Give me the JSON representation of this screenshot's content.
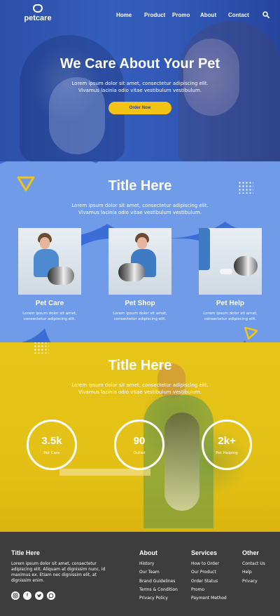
{
  "header": {
    "logo_text": "petcare",
    "nav": [
      {
        "label": "Home"
      },
      {
        "label": "Product"
      },
      {
        "label": "Promo"
      },
      {
        "label": "About"
      },
      {
        "label": "Contact"
      }
    ],
    "search_icon": "search-icon"
  },
  "hero": {
    "title": "We Care About Your Pet",
    "text": "Lorem ipsum dolor sit amet, consectetur adipiscing elit. Vivamus lacinia odio vitae vestibulum vestibulum.",
    "button": "Order Now"
  },
  "services": {
    "title": "Title Here",
    "text": "Lorem ipsum dolor sit amet, consectetur adipiscing elit. Vivamus lacinia odio vitae vestibulum vestibulum.",
    "cards": [
      {
        "title": "Pet Care",
        "text": "Lorem ipsum dolor sit amet, consectetur adipiscing elit."
      },
      {
        "title": "Pet Shop",
        "text": "Lorem ipsum dolor sit amet, consectetur adipiscing elit."
      },
      {
        "title": "Pet Help",
        "text": "Lorem ipsum dolor sit amet, consectetur adipiscing elit."
      }
    ]
  },
  "stats": {
    "title": "Title Here",
    "text": "Lorem ipsum dolor sit amet, consectetur adipiscing elit. Vivamus lacinia odio vitae vestibulum vestibulum.",
    "items": [
      {
        "value": "3.5k",
        "label": "Pet Care"
      },
      {
        "value": "90",
        "label": "Outlet"
      },
      {
        "value": "2k+",
        "label": "Pet Helping"
      }
    ]
  },
  "footer": {
    "brand_title": "Title Here",
    "brand_text": "Lorem ipsum dolor sit amet, consectetur adipiscing elit. Aliquam at dignissim nunc, id maximus ex. Etiam nec dignissim elit, at dignissim enim.",
    "socials": [
      "instagram-icon",
      "facebook-icon",
      "twitter-icon",
      "whatsapp-icon"
    ],
    "about": {
      "title": "About",
      "links": [
        "History",
        "Our Team",
        "Brand Guidelines",
        "Terms & Condition",
        "Privacy Policy"
      ]
    },
    "services": {
      "title": "Services",
      "links": [
        "How to Order",
        "Our Product",
        "Order Status",
        "Promo",
        "Payment Method"
      ]
    },
    "other": {
      "title": "Other",
      "links": [
        "Contact Us",
        "Help",
        "Privacy"
      ]
    }
  },
  "colors": {
    "hero_blue": "#3559ae",
    "section_blue": "#3c6cd6",
    "accent_yellow": "#f2c414",
    "footer_dark": "#3d3d3d"
  }
}
